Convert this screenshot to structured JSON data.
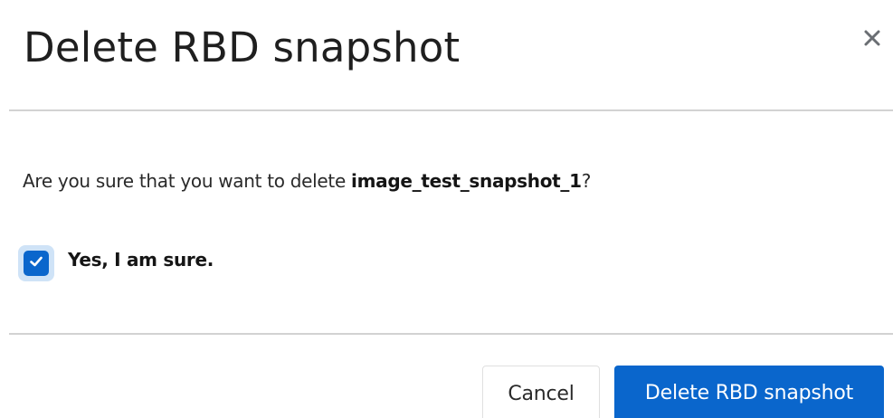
{
  "modal": {
    "title": "Delete RBD snapshot",
    "close_icon": "close-icon"
  },
  "body": {
    "message_prefix": "Are you sure that you want to delete ",
    "item_name": "image_test_snapshot_1",
    "message_suffix": "?"
  },
  "confirm": {
    "checked": true,
    "label": "Yes, I am sure.",
    "check_icon": "checkmark-icon"
  },
  "footer": {
    "cancel_label": "Cancel",
    "submit_label": "Delete RBD snapshot"
  },
  "colors": {
    "primary": "#0a66cc",
    "checkbox_focus_ring": "#cfe3f7",
    "divider": "#d2d2d2",
    "text": "#151515"
  }
}
